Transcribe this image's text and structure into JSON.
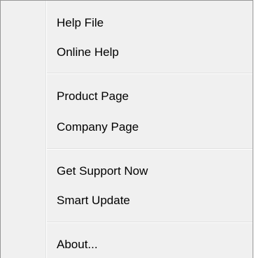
{
  "menu": {
    "groups": [
      {
        "items": [
          {
            "label": "Help File"
          },
          {
            "label": "Online Help"
          }
        ]
      },
      {
        "items": [
          {
            "label": "Product Page"
          },
          {
            "label": "Company Page"
          }
        ]
      },
      {
        "items": [
          {
            "label": "Get Support Now"
          },
          {
            "label": "Smart Update"
          }
        ]
      },
      {
        "items": [
          {
            "label": "About..."
          }
        ]
      }
    ]
  },
  "colors": {
    "background": "#f0f0f0",
    "border": "#979797",
    "separator": "#e0e0e0",
    "text": "#000000"
  }
}
